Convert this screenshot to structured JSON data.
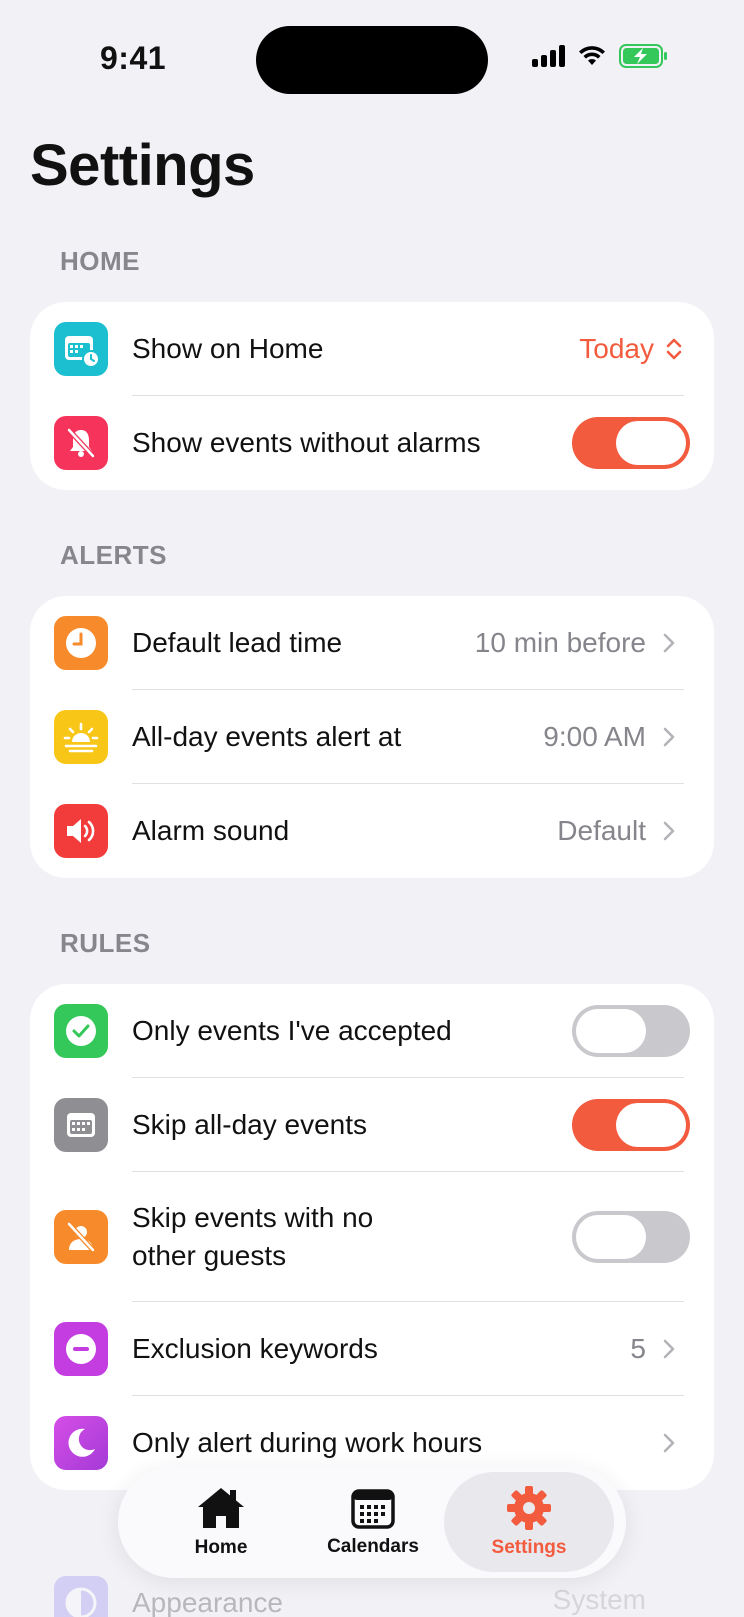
{
  "status_bar": {
    "time": "9:41"
  },
  "page_title": "Settings",
  "sections": {
    "home": {
      "label": "HOME",
      "show_on_home": {
        "label": "Show on Home",
        "value": "Today"
      },
      "show_events_without_alarms": {
        "label": "Show events without alarms",
        "toggle": true
      }
    },
    "alerts": {
      "label": "ALERTS",
      "default_lead_time": {
        "label": "Default lead time",
        "value": "10 min before"
      },
      "all_day_alert": {
        "label": "All-day events alert at",
        "value": "9:00 AM"
      },
      "alarm_sound": {
        "label": "Alarm sound",
        "value": "Default"
      }
    },
    "rules": {
      "label": "RULES",
      "only_accepted": {
        "label": "Only events I've accepted",
        "toggle": false
      },
      "skip_all_day": {
        "label": "Skip all-day events",
        "toggle": true
      },
      "skip_no_guests": {
        "label_line1": "Skip events with no",
        "label_line2": "other guests",
        "toggle": false
      },
      "exclusion_keywords": {
        "label": "Exclusion keywords",
        "value": "5"
      },
      "work_hours": {
        "label": "Only alert during work hours"
      }
    },
    "faded": {
      "label": "Appearance",
      "value": "System"
    }
  },
  "tab_bar": {
    "home": "Home",
    "calendars": "Calendars",
    "settings": "Settings",
    "active": "settings"
  },
  "colors": {
    "accent": "#f25b3e",
    "background": "#f2f1f6",
    "icon_teal": "#1bbfcf",
    "icon_pink": "#f6335a",
    "icon_orange": "#f78a2a",
    "icon_yellow": "#f8c617",
    "icon_red": "#f23b3b",
    "icon_green": "#34c759",
    "icon_gray": "#8e8e93",
    "icon_purple": "#c33de0"
  }
}
